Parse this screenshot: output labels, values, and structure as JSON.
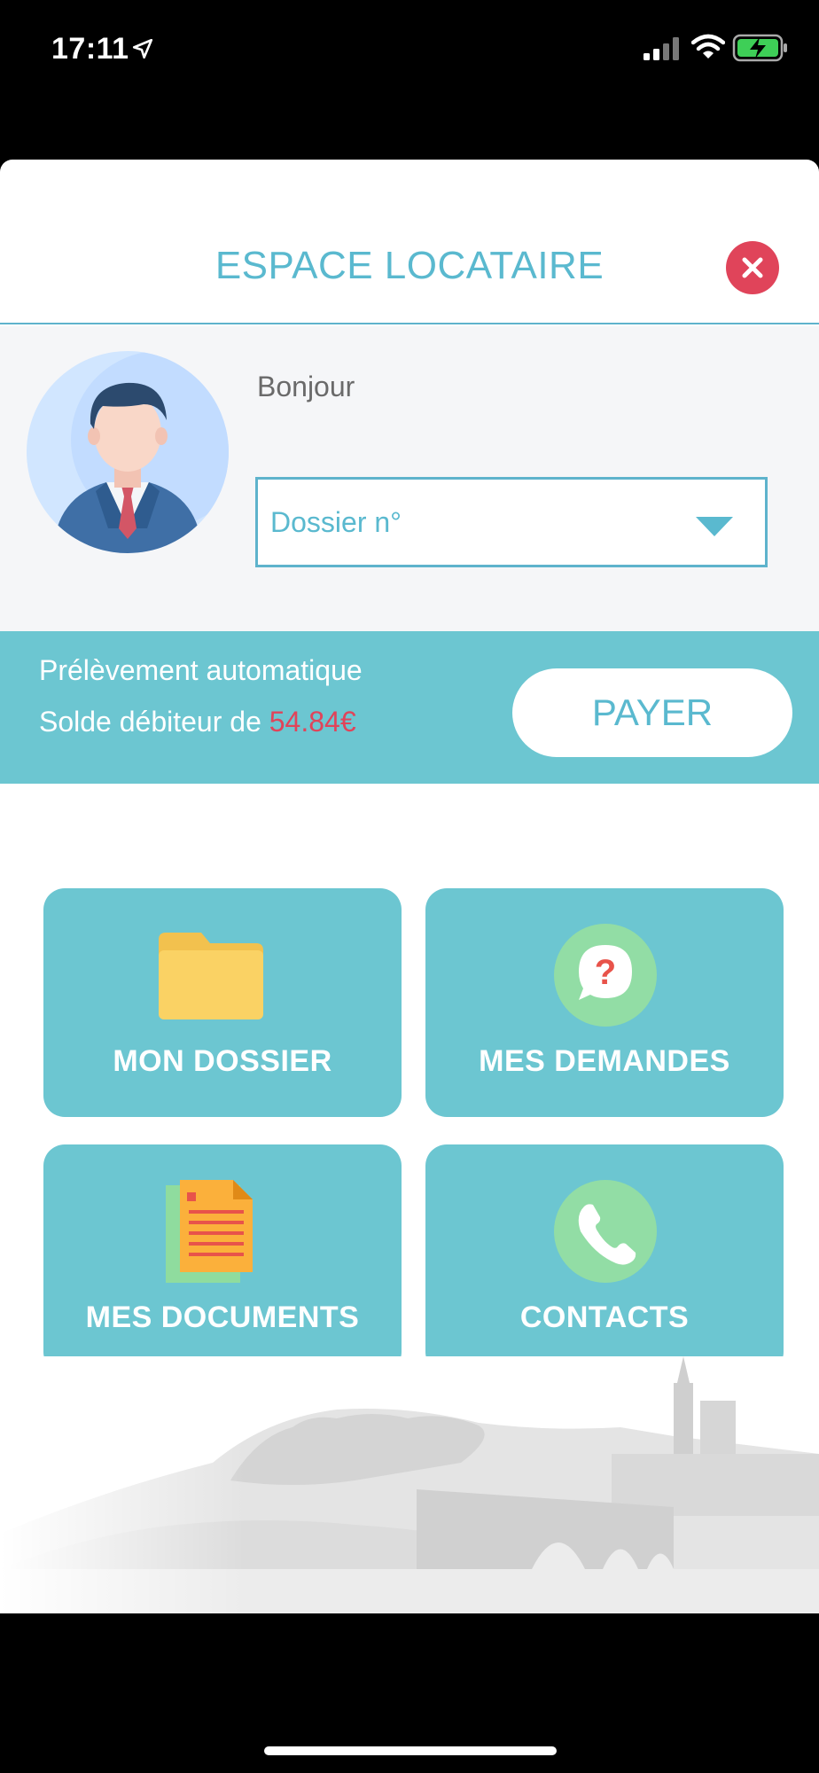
{
  "status_bar": {
    "time": "17:11"
  },
  "header": {
    "title": "ESPACE LOCATAIRE"
  },
  "profile": {
    "greeting": "Bonjour",
    "dossier_label": "Dossier n°"
  },
  "payment": {
    "line1": "Prélèvement automatique",
    "line2_prefix": "Solde débiteur de",
    "amount": "54.84€",
    "pay_label": "PAYER"
  },
  "tiles": [
    {
      "label": "MON DOSSIER",
      "icon": "folder-icon"
    },
    {
      "label": "MES DEMANDES",
      "icon": "question-bubble-icon"
    },
    {
      "label": "MES DOCUMENTS",
      "icon": "documents-icon"
    },
    {
      "label": "CONTACTS",
      "icon": "phone-icon"
    }
  ],
  "colors": {
    "accent": "#5ab9cf",
    "banner": "#6cc6d1",
    "alert": "#e0445a"
  }
}
